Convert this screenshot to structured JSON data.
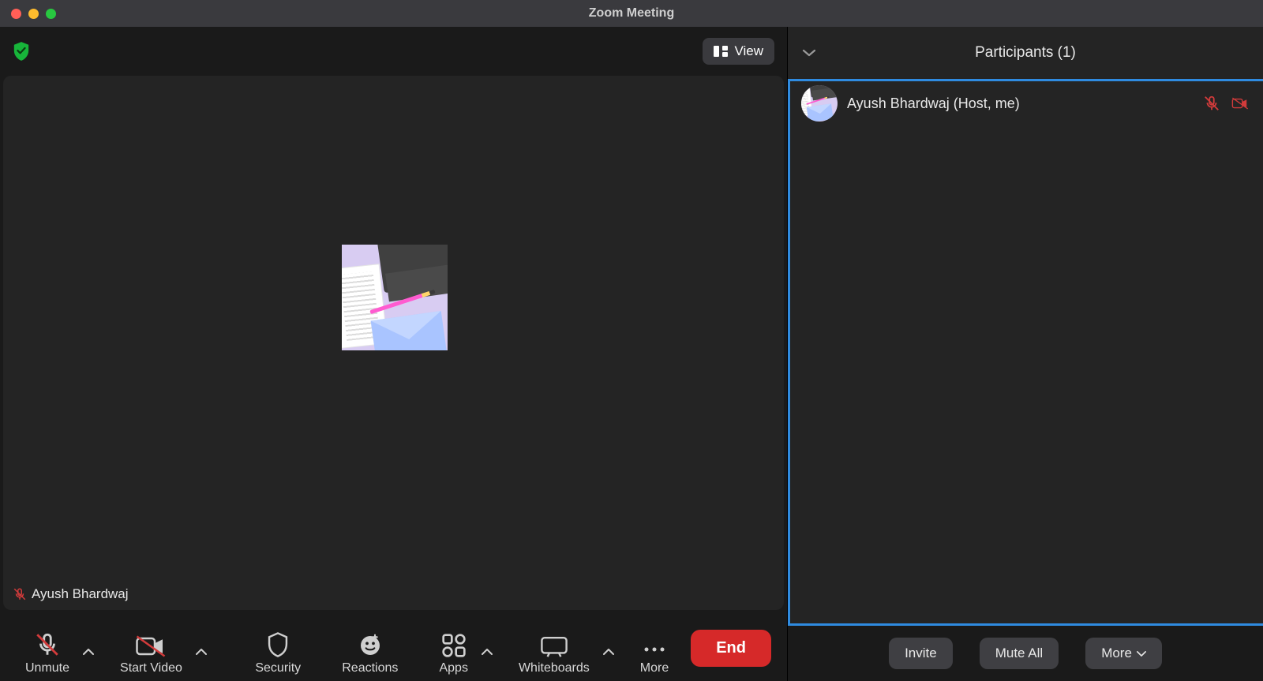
{
  "titlebar": {
    "title": "Zoom Meeting"
  },
  "top": {
    "view_label": "View"
  },
  "video": {
    "self_name": "Ayush Bhardwaj"
  },
  "toolbar": {
    "unmute": "Unmute",
    "start_video": "Start Video",
    "security": "Security",
    "reactions": "Reactions",
    "apps": "Apps",
    "whiteboards": "Whiteboards",
    "more": "More",
    "end": "End"
  },
  "participants": {
    "header": "Participants (1)",
    "items": [
      {
        "name": "Ayush Bhardwaj (Host, me)"
      }
    ],
    "footer": {
      "invite": "Invite",
      "mute_all": "Mute All",
      "more": "More"
    }
  }
}
